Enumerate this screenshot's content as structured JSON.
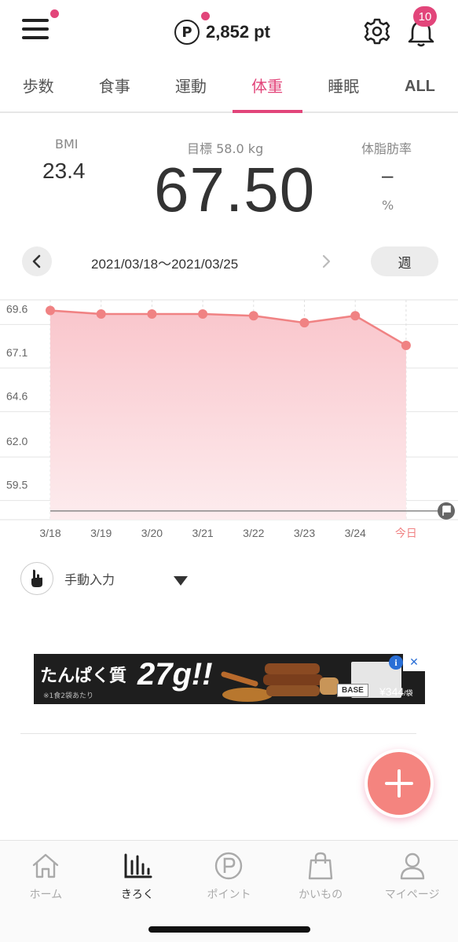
{
  "header": {
    "points_icon": "P",
    "points_value": "2,852 pt",
    "notification_count": "10"
  },
  "tabs": [
    {
      "label": "歩数"
    },
    {
      "label": "食事"
    },
    {
      "label": "運動"
    },
    {
      "label": "体重",
      "active": true
    },
    {
      "label": "睡眠"
    },
    {
      "label": "ALL"
    }
  ],
  "stats": {
    "bmi_label": "BMI",
    "bmi_value": "23.4",
    "goal_label": "目標 58.0 kg",
    "weight_value": "67.50",
    "bodyfat_label": "体脂肪率",
    "bodyfat_value": "–",
    "bodyfat_unit": "%"
  },
  "date_nav": {
    "range": "2021/03/18～2021/03/25",
    "period": "週"
  },
  "chart_data": {
    "type": "line",
    "categories": [
      "3/18",
      "3/19",
      "3/20",
      "3/21",
      "3/22",
      "3/23",
      "3/24",
      "今日"
    ],
    "series": [
      {
        "values": [
          69.5,
          69.3,
          69.3,
          69.3,
          69.2,
          68.8,
          69.2,
          67.5
        ]
      }
    ],
    "y_ticks": [
      "69.6",
      "67.1",
      "64.6",
      "62.0",
      "59.5"
    ],
    "ylim": [
      57.5,
      70.2
    ],
    "goal_line": 58.0,
    "colors": {
      "line": "#f08283",
      "fill_top": "#f9c6cc",
      "fill_bottom": "#fdecee",
      "goal": "#888888"
    }
  },
  "manual_input": {
    "label": "手動入力"
  },
  "ad": {
    "headline": "たんぱく質",
    "big_text": "27g!!",
    "note": "※1食2袋あたり",
    "brand": "BASE",
    "price": "¥344",
    "price_suffix": "/袋",
    "info": "i",
    "close": "✕"
  },
  "bottom_nav": [
    {
      "label": "ホーム",
      "icon": "home-icon"
    },
    {
      "label": "きろく",
      "icon": "chart-icon",
      "active": true
    },
    {
      "label": "ポイント",
      "icon": "points-icon"
    },
    {
      "label": "かいもの",
      "icon": "shopping-bag-icon"
    },
    {
      "label": "マイページ",
      "icon": "person-icon"
    }
  ]
}
